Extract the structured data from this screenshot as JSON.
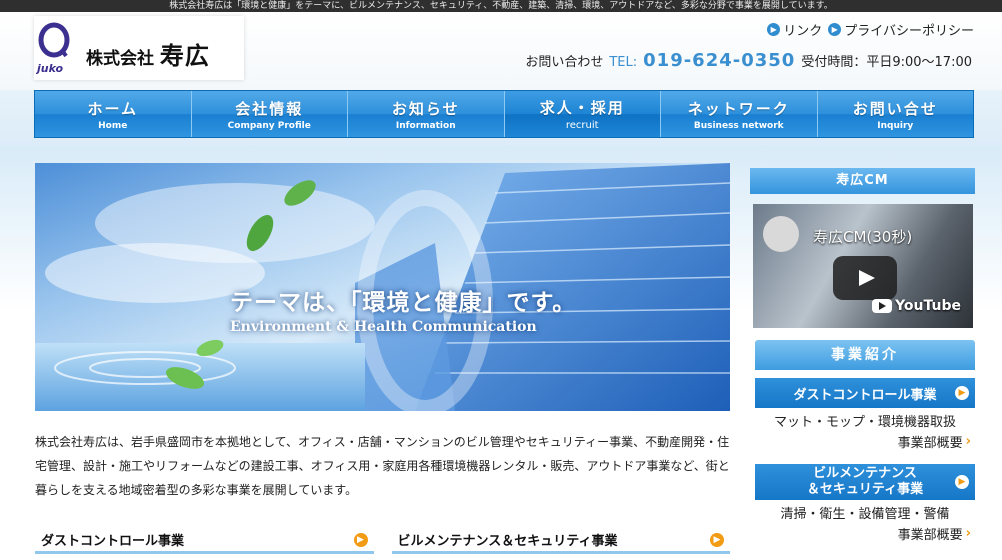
{
  "topbar": {
    "text": "株式会社寿広は「環境と健康」をテーマに、ビルメンテナンス、セキュリティ、不動産、建築、清掃、環境、アウトドアなど、多彩な分野で事業を展開しています。"
  },
  "header": {
    "logo_mark": "juko",
    "company_prefix": "株式会社",
    "company_name": "寿広",
    "links": [
      {
        "label": "リンク"
      },
      {
        "label": "プライバシーポリシー"
      }
    ],
    "contact_label": "お問い合わせ",
    "tel_label": "TEL:",
    "tel": "019-624-0350",
    "hours": "受付時間：平日9:00〜17:00"
  },
  "nav": [
    {
      "jp": "ホーム",
      "en": "Home"
    },
    {
      "jp": "会社情報",
      "en": "Company Profile"
    },
    {
      "jp": "お知らせ",
      "en": "Information"
    },
    {
      "jp": "求人・採用",
      "en": "recruit"
    },
    {
      "jp": "ネットワーク",
      "en": "Business network"
    },
    {
      "jp": "お問い合せ",
      "en": "Inquiry"
    }
  ],
  "hero": {
    "headline": "テーマは、「環境と健康」です。",
    "subline": "Environment & Health Communication"
  },
  "intro": "株式会社寿広は、岩手県盛岡市を本拠地として、オフィス・店舗・マンションのビル管理やセキュリティー事業、不動産開発・住宅管理、設計・施工やリフォームなどの建設工事、オフィス用・家庭用各種環境機器レンタル・販売、アウトドア事業など、街と暮らしを支える地域密着型の多彩な事業を展開しています。",
  "sections": [
    {
      "label": "ダストコントロール事業"
    },
    {
      "label": "ビルメンテナンス＆セキュリティ事業"
    }
  ],
  "sidebar": {
    "cm_title": "寿広CM",
    "video_title": "寿広CM(30秒)",
    "youtube_label": "YouTube",
    "biz_title": "事業紹介",
    "biz": [
      {
        "line1": "ダストコントロール事業",
        "line2": "",
        "desc": "マット・モップ・環境機器取扱",
        "more": "事業部概要"
      },
      {
        "line1": "ビルメンテナンス",
        "line2": "＆セキュリティ事業",
        "desc": "清掃・衛生・設備管理・警備",
        "more": "事業部概要"
      }
    ]
  },
  "colors": {
    "accent": "#2d8fdb",
    "orange": "#f29b14",
    "tel": "#3a8fd0"
  }
}
